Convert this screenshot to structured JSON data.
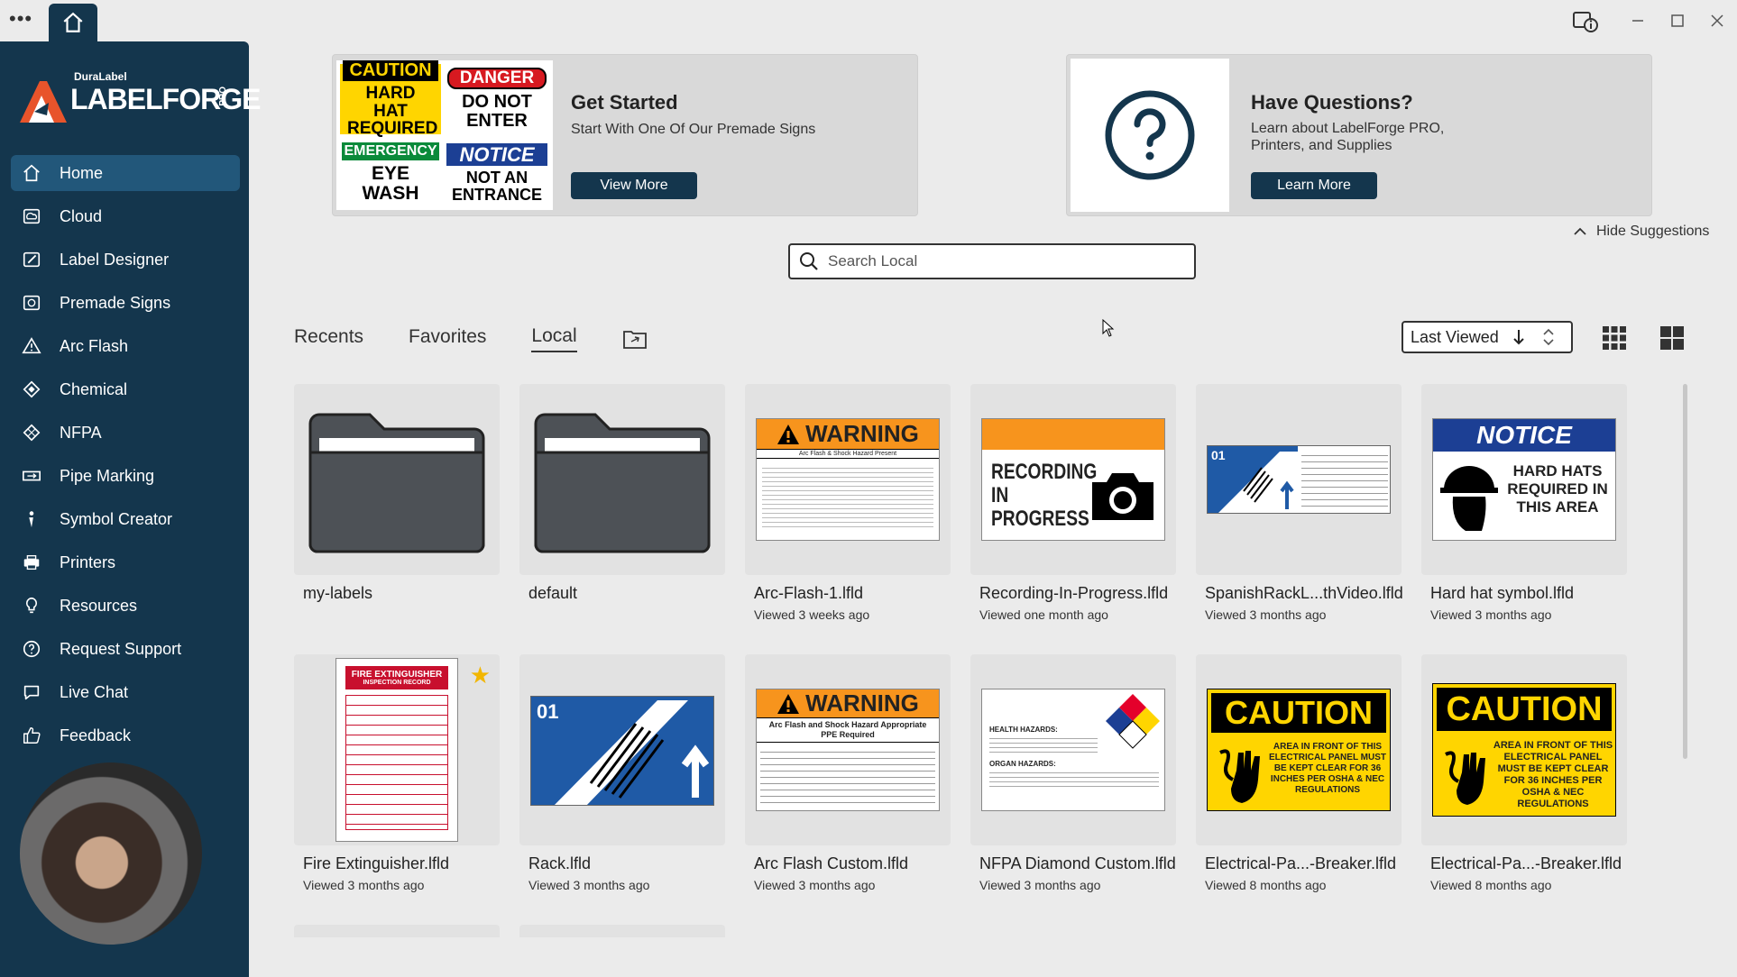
{
  "titlebar": {
    "dots": "•••"
  },
  "brand": {
    "small": "DuraLabel",
    "name": "LABELFORGE",
    "tag": "PRO"
  },
  "sidebar": {
    "items": [
      {
        "label": "Home",
        "icon": "home-icon"
      },
      {
        "label": "Cloud",
        "icon": "cloud-icon"
      },
      {
        "label": "Label Designer",
        "icon": "label-designer-icon"
      },
      {
        "label": "Premade Signs",
        "icon": "premade-signs-icon"
      },
      {
        "label": "Arc Flash",
        "icon": "warning-triangle-icon"
      },
      {
        "label": "Chemical",
        "icon": "diamond-icon"
      },
      {
        "label": "NFPA",
        "icon": "diamond-icon"
      },
      {
        "label": "Pipe Marking",
        "icon": "pipe-icon"
      },
      {
        "label": "Symbol Creator",
        "icon": "symbol-icon"
      },
      {
        "label": "Printers",
        "icon": "printer-icon"
      },
      {
        "label": "Resources",
        "icon": "lightbulb-icon"
      },
      {
        "label": "Request Support",
        "icon": "question-icon"
      },
      {
        "label": "Live Chat",
        "icon": "chat-icon"
      },
      {
        "label": "Feedback",
        "icon": "thumbs-up-icon"
      }
    ]
  },
  "banner_start": {
    "signs": {
      "caution": "CAUTION",
      "hard_hat": "HARD HAT REQUIRED",
      "danger": "DANGER",
      "do_not_enter": "DO NOT ENTER",
      "emergency": "EMERGENCY",
      "eye_wash": "EYE WASH",
      "notice": "NOTICE",
      "not_entrance": "NOT AN ENTRANCE"
    },
    "title": "Get Started",
    "subtitle": "Start With One Of Our Premade Signs",
    "button": "View More"
  },
  "banner_questions": {
    "title": "Have Questions?",
    "subtitle_1": "Learn about LabelForge PRO,",
    "subtitle_2": "Printers, and Supplies",
    "button": "Learn More"
  },
  "hide_suggestions": "Hide Suggestions",
  "search": {
    "placeholder": "Search Local"
  },
  "tabs": [
    "Recents",
    "Favorites",
    "Local"
  ],
  "active_tab": "Local",
  "sort": {
    "label": "Last Viewed"
  },
  "files": [
    {
      "name": "my-labels",
      "meta": "",
      "kind": "folder"
    },
    {
      "name": "default",
      "meta": "",
      "kind": "folder"
    },
    {
      "name": "Arc-Flash-1.lfld",
      "meta": "Viewed 3 weeks ago",
      "kind": "arc-warning",
      "thumb_title": "WARNING",
      "thumb_sub": "Arc Flash & Shock Hazard Present"
    },
    {
      "name": "Recording-In-Progress.lfld",
      "meta": "Viewed one month ago",
      "kind": "recording",
      "thumb_title": "RECORDING IN PROGRESS"
    },
    {
      "name": "SpanishRackL...thVideo.lfld",
      "meta": "Viewed 3 months ago",
      "kind": "rack-spanish",
      "thumb_title": "01"
    },
    {
      "name": "Hard hat symbol.lfld",
      "meta": "Viewed 3 months ago",
      "kind": "notice",
      "thumb_title": "NOTICE",
      "thumb_sub": "HARD HATS REQUIRED IN THIS AREA"
    },
    {
      "name": "Fire Extinguisher.lfld",
      "meta": "Viewed 3 months ago",
      "kind": "fire",
      "thumb_title": "FIRE EXTINGUISHER",
      "thumb_sub": "INSPECTION RECORD",
      "favorite": true
    },
    {
      "name": "Rack.lfld",
      "meta": "Viewed 3 months ago",
      "kind": "rack",
      "thumb_title": "01"
    },
    {
      "name": "Arc Flash Custom.lfld",
      "meta": "Viewed 3 months ago",
      "kind": "arc-warning-2",
      "thumb_title": "WARNING",
      "thumb_sub": "Arc Flash and Shock Hazard Appropriate PPE Required"
    },
    {
      "name": "NFPA Diamond Custom.lfld",
      "meta": "Viewed 3 months ago",
      "kind": "nfpa",
      "thumb_title": "HEALTH HAZARDS:",
      "thumb_sub": "ORGAN HAZARDS:"
    },
    {
      "name": "Electrical-Pa...-Breaker.lfld",
      "meta": "Viewed 8 months ago",
      "kind": "caution",
      "thumb_title": "CAUTION",
      "thumb_sub": "AREA IN FRONT OF THIS ELECTRICAL PANEL MUST BE KEPT CLEAR FOR 36 INCHES PER OSHA & NEC REGULATIONS"
    },
    {
      "name": "Electrical-Pa...-Breaker.lfld",
      "meta": "Viewed 8 months ago",
      "kind": "caution",
      "thumb_title": "CAUTION",
      "thumb_sub": "AREA IN FRONT OF THIS ELECTRICAL PANEL MUST BE KEPT CLEAR FOR 36 INCHES PER OSHA & NEC REGULATIONS"
    }
  ],
  "colors": {
    "sidebar": "#14364d",
    "sidebar_active": "#22577a",
    "accent_button": "#14364d",
    "favorite_star": "#f2b600"
  }
}
